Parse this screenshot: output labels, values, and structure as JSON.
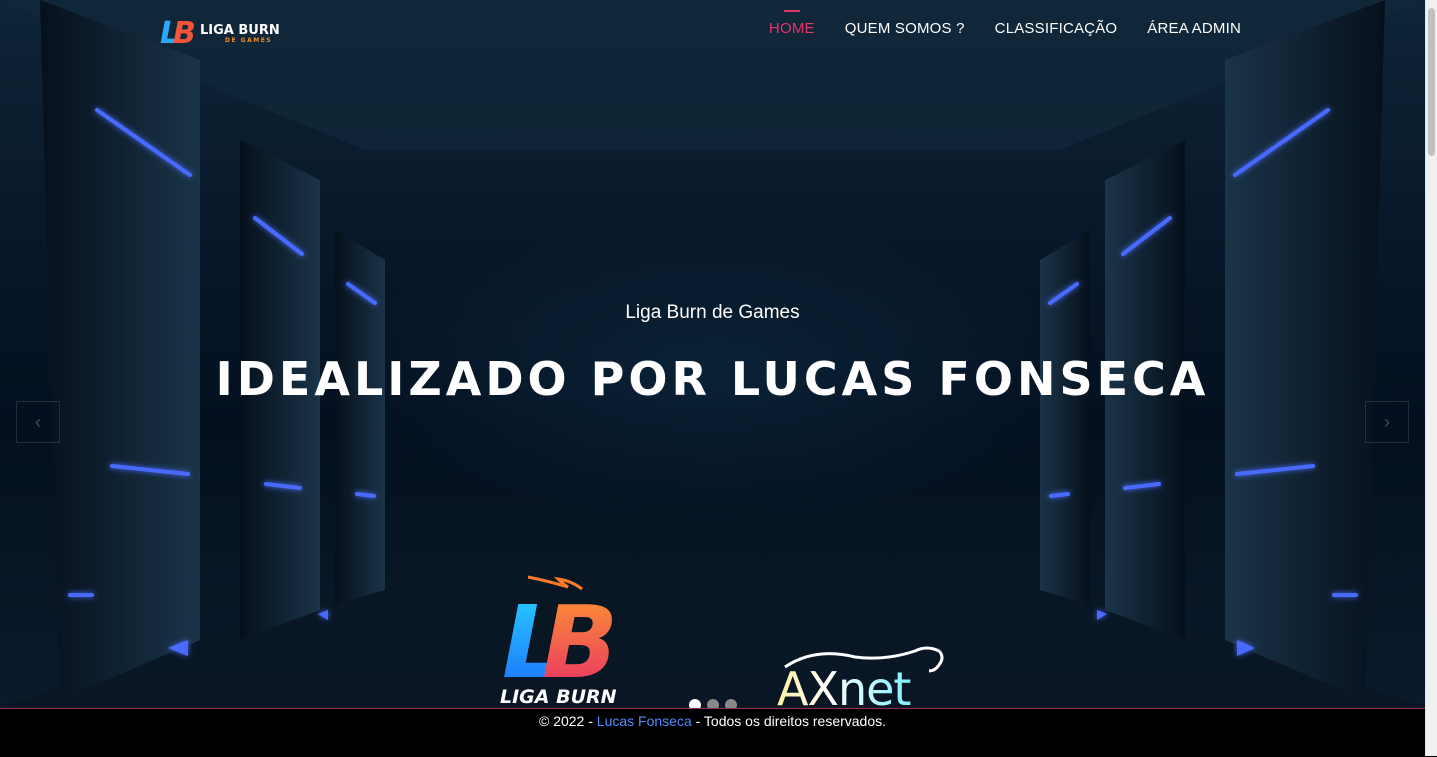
{
  "brand": {
    "logo_line1": "LIGA BURN",
    "logo_line2": "DE GAMES",
    "mark": "LB"
  },
  "nav": [
    {
      "label": "HOME",
      "active": true
    },
    {
      "label": "QUEM SOMOS ?",
      "active": false
    },
    {
      "label": "CLASSIFICAÇÃO",
      "active": false
    },
    {
      "label": "ÁREA ADMIN",
      "active": false
    }
  ],
  "hero": {
    "subtitle": "Liga Burn de Games",
    "title": "IDEALIZADO POR LUCAS FONSECA",
    "prev_icon": "chevron-left-icon",
    "next_icon": "chevron-right-icon",
    "slides_total": 3,
    "active_slide": 1
  },
  "sponsors": {
    "liga_burn": {
      "mark": "LB",
      "text": "LIGA BURN"
    },
    "axnet": {
      "text": "AXnet"
    }
  },
  "footer": {
    "prefix": "© 2022 - ",
    "author": "Lucas Fonseca",
    "suffix": " - Todos os direitos reservados."
  },
  "colors": {
    "accent": "#e6336a",
    "link": "#4f8cff",
    "neon": "#3a5cff"
  }
}
